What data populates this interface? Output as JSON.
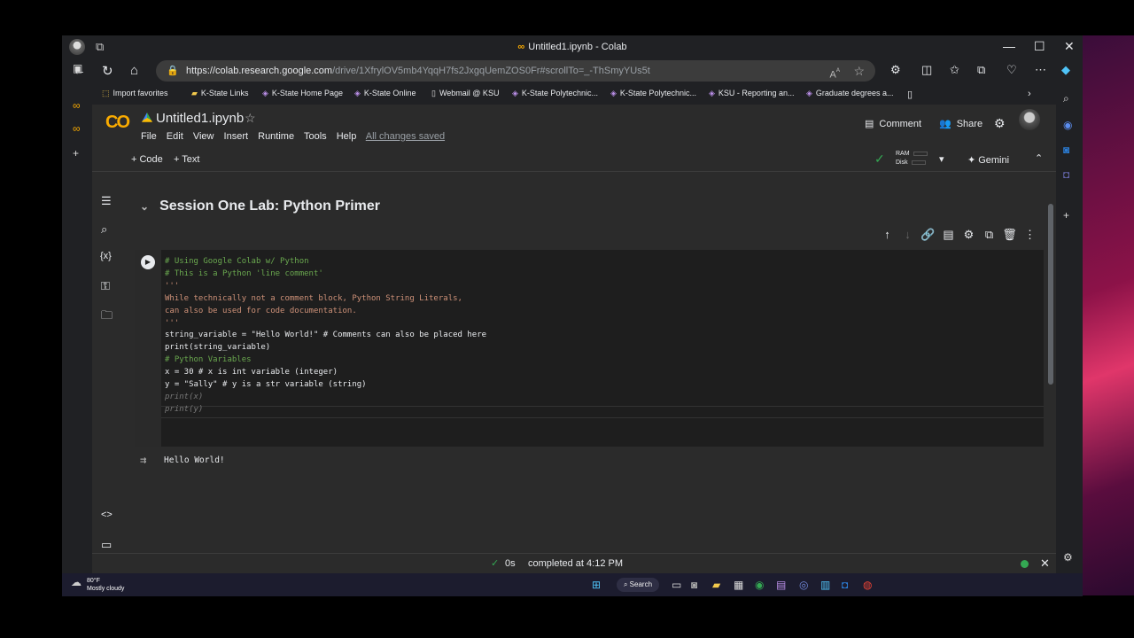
{
  "window": {
    "title": "Untitled1.ipynb - Colab",
    "minimize": "—",
    "maximize": "☐",
    "close": "✕"
  },
  "address_bar": {
    "url_host": "https://colab.research.google.com",
    "url_path": "/drive/1XfrylOV5mb4YqqH7fs2JxgqUemZOS0Fr#scrollTo=_-ThSmyYUs5t"
  },
  "bookmarks": [
    "Import favorites",
    "K-State Links",
    "K-State Home Page",
    "K-State Online",
    "Webmail @ KSU",
    "K-State Polytechnic...",
    "K-State Polytechnic...",
    "KSU - Reporting an...",
    "Graduate degrees a..."
  ],
  "colab": {
    "logo": "CO",
    "filename": "Untitled1.ipynb",
    "menu": [
      "File",
      "Edit",
      "View",
      "Insert",
      "Runtime",
      "Tools",
      "Help"
    ],
    "saved_status": "All changes saved",
    "comment_label": "Comment",
    "share_label": "Share",
    "add_code_label": "+ Code",
    "add_text_label": "+ Text",
    "ram_label": "RAM",
    "disk_label": "Disk",
    "gemini_label": "Gemini"
  },
  "notebook": {
    "section_title": "Session One Lab: Python Primer",
    "code_lines": [
      "# Using Google Colab w/ Python",
      "# This is a Python 'line comment'",
      "'''",
      "While technically not a comment block, Python String Literals,",
      "can also be used for code documentation.",
      "'''",
      "string_variable = \"Hello World!\" # Comments can also be placed here",
      "print(string_variable)",
      "",
      "# Python Variables",
      "x = 30 # x is int variable (integer)",
      "y = \"Sally\" # y is a str variable (string)",
      "print(x)",
      "print(y)"
    ],
    "output": "Hello World!"
  },
  "status_bar": {
    "duration": "0s",
    "completed": "completed at 4:12 PM"
  },
  "taskbar": {
    "temperature": "80°F",
    "weather": "Mostly cloudy",
    "search_label": "Search"
  },
  "colors": {
    "accent": "#f9ab00",
    "success": "#34a853",
    "comment": "#6aa84f",
    "string": "#ce9178"
  }
}
